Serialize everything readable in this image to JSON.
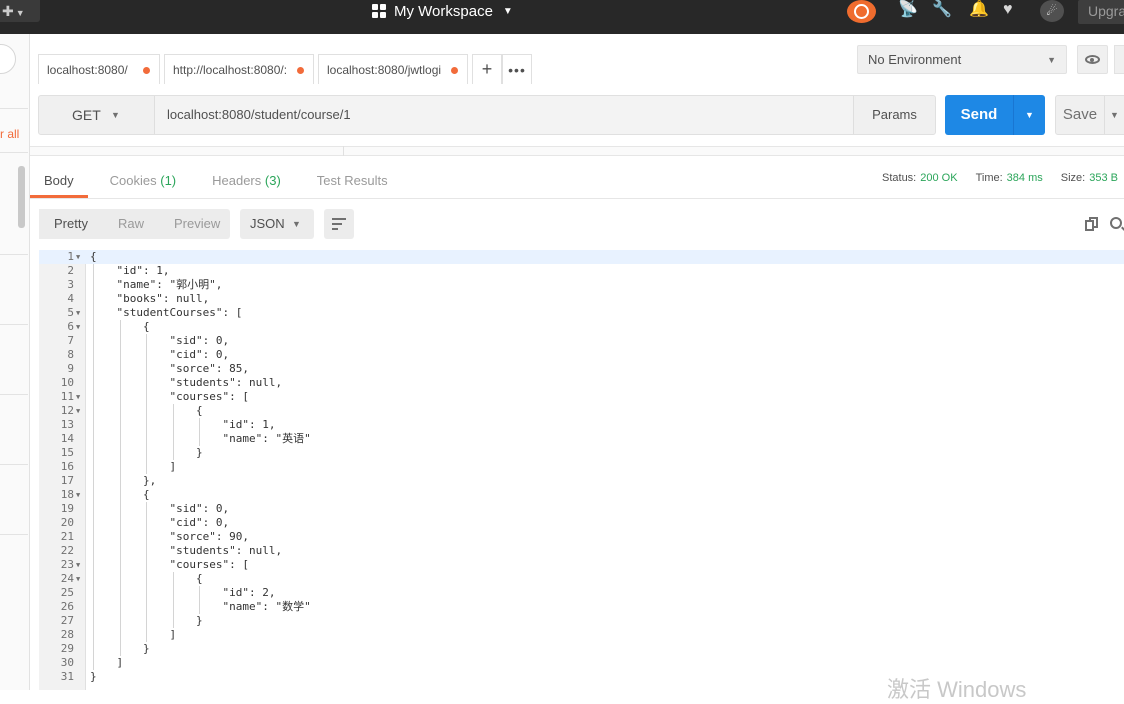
{
  "topbar": {
    "workspace": "My Workspace",
    "upgrade": "Upgra",
    "icons": [
      "new-icon",
      "grid-icon",
      "sync-icon",
      "satellite-icon",
      "wrench-icon",
      "bell-icon",
      "heart-icon",
      "profile-icon"
    ]
  },
  "sidebar": {
    "link": "r all"
  },
  "tabs": [
    {
      "label": "localhost:8080/"
    },
    {
      "label": "http://localhost:8080/:"
    },
    {
      "label": "localhost:8080/jwtlogi"
    }
  ],
  "environment": {
    "selected": "No Environment"
  },
  "request": {
    "method": "GET",
    "url": "localhost:8080/student/course/1",
    "params": "Params",
    "send": "Send",
    "save": "Save"
  },
  "response": {
    "tabs": [
      {
        "label": "Body",
        "count": ""
      },
      {
        "label": "Cookies",
        "count": "(1)"
      },
      {
        "label": "Headers",
        "count": "(3)"
      },
      {
        "label": "Test Results",
        "count": ""
      }
    ],
    "status_label": "Status:",
    "status_value": "200 OK",
    "time_label": "Time:",
    "time_value": "384 ms",
    "size_label": "Size:",
    "size_value": "353 B",
    "views": [
      "Pretty",
      "Raw",
      "Preview"
    ],
    "format": "JSON"
  },
  "code_lines": [
    {
      "n": "1",
      "fold": true,
      "indent": 0,
      "text": "{"
    },
    {
      "n": "2",
      "fold": false,
      "indent": 1,
      "text": "\"id\": 1,"
    },
    {
      "n": "3",
      "fold": false,
      "indent": 1,
      "text": "\"name\": \"郭小明\","
    },
    {
      "n": "4",
      "fold": false,
      "indent": 1,
      "text": "\"books\": null,"
    },
    {
      "n": "5",
      "fold": true,
      "indent": 1,
      "text": "\"studentCourses\": ["
    },
    {
      "n": "6",
      "fold": true,
      "indent": 2,
      "text": "{"
    },
    {
      "n": "7",
      "fold": false,
      "indent": 3,
      "text": "\"sid\": 0,"
    },
    {
      "n": "8",
      "fold": false,
      "indent": 3,
      "text": "\"cid\": 0,"
    },
    {
      "n": "9",
      "fold": false,
      "indent": 3,
      "text": "\"sorce\": 85,"
    },
    {
      "n": "10",
      "fold": false,
      "indent": 3,
      "text": "\"students\": null,"
    },
    {
      "n": "11",
      "fold": true,
      "indent": 3,
      "text": "\"courses\": ["
    },
    {
      "n": "12",
      "fold": true,
      "indent": 4,
      "text": "{"
    },
    {
      "n": "13",
      "fold": false,
      "indent": 5,
      "text": "\"id\": 1,"
    },
    {
      "n": "14",
      "fold": false,
      "indent": 5,
      "text": "\"name\": \"英语\""
    },
    {
      "n": "15",
      "fold": false,
      "indent": 4,
      "text": "}"
    },
    {
      "n": "16",
      "fold": false,
      "indent": 3,
      "text": "]"
    },
    {
      "n": "17",
      "fold": false,
      "indent": 2,
      "text": "},"
    },
    {
      "n": "18",
      "fold": true,
      "indent": 2,
      "text": "{"
    },
    {
      "n": "19",
      "fold": false,
      "indent": 3,
      "text": "\"sid\": 0,"
    },
    {
      "n": "20",
      "fold": false,
      "indent": 3,
      "text": "\"cid\": 0,"
    },
    {
      "n": "21",
      "fold": false,
      "indent": 3,
      "text": "\"sorce\": 90,"
    },
    {
      "n": "22",
      "fold": false,
      "indent": 3,
      "text": "\"students\": null,"
    },
    {
      "n": "23",
      "fold": true,
      "indent": 3,
      "text": "\"courses\": ["
    },
    {
      "n": "24",
      "fold": true,
      "indent": 4,
      "text": "{"
    },
    {
      "n": "25",
      "fold": false,
      "indent": 5,
      "text": "\"id\": 2,"
    },
    {
      "n": "26",
      "fold": false,
      "indent": 5,
      "text": "\"name\": \"数学\""
    },
    {
      "n": "27",
      "fold": false,
      "indent": 4,
      "text": "}"
    },
    {
      "n": "28",
      "fold": false,
      "indent": 3,
      "text": "]"
    },
    {
      "n": "29",
      "fold": false,
      "indent": 2,
      "text": "}"
    },
    {
      "n": "30",
      "fold": false,
      "indent": 1,
      "text": "]"
    },
    {
      "n": "31",
      "fold": false,
      "indent": 0,
      "text": "}"
    }
  ],
  "watermark": "激活 Windows",
  "colors": {
    "accent": "#f26b3a",
    "send": "#1e88e5",
    "status_ok": "#2ba55a",
    "topbar": "#282828"
  }
}
